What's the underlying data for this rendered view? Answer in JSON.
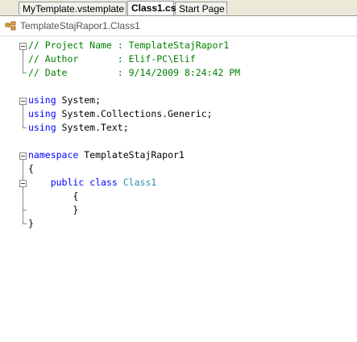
{
  "tabs": [
    {
      "label": "MyTemplate.vstemplate",
      "active": false
    },
    {
      "label": "Class1.cs",
      "active": true
    },
    {
      "label": "Start Page",
      "active": false
    }
  ],
  "navbar": {
    "icon": "class-icon",
    "label": "TemplateStajRapor1.Class1"
  },
  "code": {
    "comment_project": "// Project Name : TemplateStajRapor1",
    "comment_author": "// Author       : Elif-PC\\Elif",
    "comment_date": "// Date         : 9/14/2009 8:24:42 PM",
    "using_kw": "using",
    "using1": " System;",
    "using2": " System.Collections.Generic;",
    "using3": " System.Text;",
    "namespace_kw": "namespace",
    "namespace_name": " TemplateStajRapor1",
    "brace_open": "{",
    "indent": "    ",
    "public_kw": "public",
    "class_kw": "class",
    "class_name": "Class1",
    "inner_open": "        {",
    "inner_close": "        }",
    "brace_close": "}"
  },
  "colors": {
    "comment": "#008000",
    "keyword": "#0000ff",
    "type": "#2b91af"
  }
}
